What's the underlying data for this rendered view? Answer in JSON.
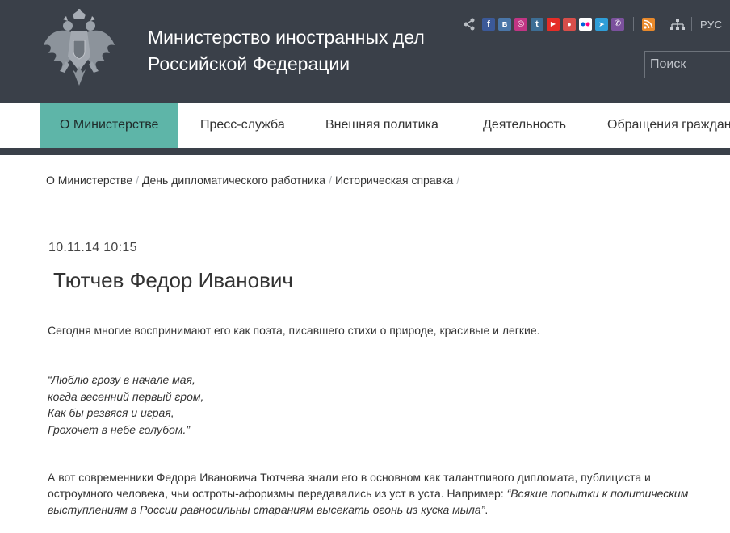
{
  "header": {
    "title_line1": "Министерство иностранных дел",
    "title_line2": "Российской Федерации",
    "lang_label": "РУС",
    "search_placeholder": "Поиск",
    "social_icons": [
      {
        "name": "facebook-icon",
        "glyph": "f",
        "color": "#3b5998"
      },
      {
        "name": "vk-icon",
        "glyph": "в",
        "color": "#4a76a8"
      },
      {
        "name": "instagram-icon",
        "glyph": "◎",
        "color": "#c13584"
      },
      {
        "name": "tumblr-icon",
        "glyph": "t",
        "color": "#3d6e95"
      },
      {
        "name": "youtube-icon",
        "glyph": "▶",
        "color": "#e52d27"
      },
      {
        "name": "periscope-icon",
        "glyph": "●",
        "color": "#d74e4a"
      },
      {
        "name": "flickr-icon",
        "glyph": "••",
        "color": "#ffffff"
      },
      {
        "name": "telegram-icon",
        "glyph": "➤",
        "color": "#2f9ed8"
      },
      {
        "name": "viber-icon",
        "glyph": "✆",
        "color": "#7b519d"
      }
    ]
  },
  "nav": {
    "items": [
      {
        "label": "О Министерстве",
        "active": true
      },
      {
        "label": "Пресс-служба",
        "active": false
      },
      {
        "label": "Внешняя политика",
        "active": false
      },
      {
        "label": "Деятельность",
        "active": false
      },
      {
        "label": "Обращения граждан",
        "active": false
      }
    ]
  },
  "breadcrumb": {
    "items": [
      "О Министерстве",
      "День дипломатического работника",
      "Историческая справка"
    ]
  },
  "article": {
    "date": "10.11.14 10:15",
    "title": "Тютчев Федор Иванович",
    "intro": "Сегодня многие воспринимают его как поэта, писавшего стихи о природе, красивые и легкие.",
    "poem": [
      "“Люблю грозу в начале мая,",
      "когда весенний первый гром,",
      "Как бы резвяся и играя,",
      "Грохочет в небе голубом.”"
    ],
    "para2_plain": "А вот современники Федора Ивановича Тютчева знали его в основном как талантливого дипломата, публициста и остроумного человека, чьи остроты-афоризмы передавались из уст в уста. Например: ",
    "para2_quote": "“Всякие попытки к политическим выступлениям в России равносильны стараниям высекать огонь из куска мыла”",
    "para2_end": "."
  },
  "colors": {
    "header_bg": "#3a4049",
    "nav_active": "#5eb5a8",
    "rss": "#e8892b"
  }
}
